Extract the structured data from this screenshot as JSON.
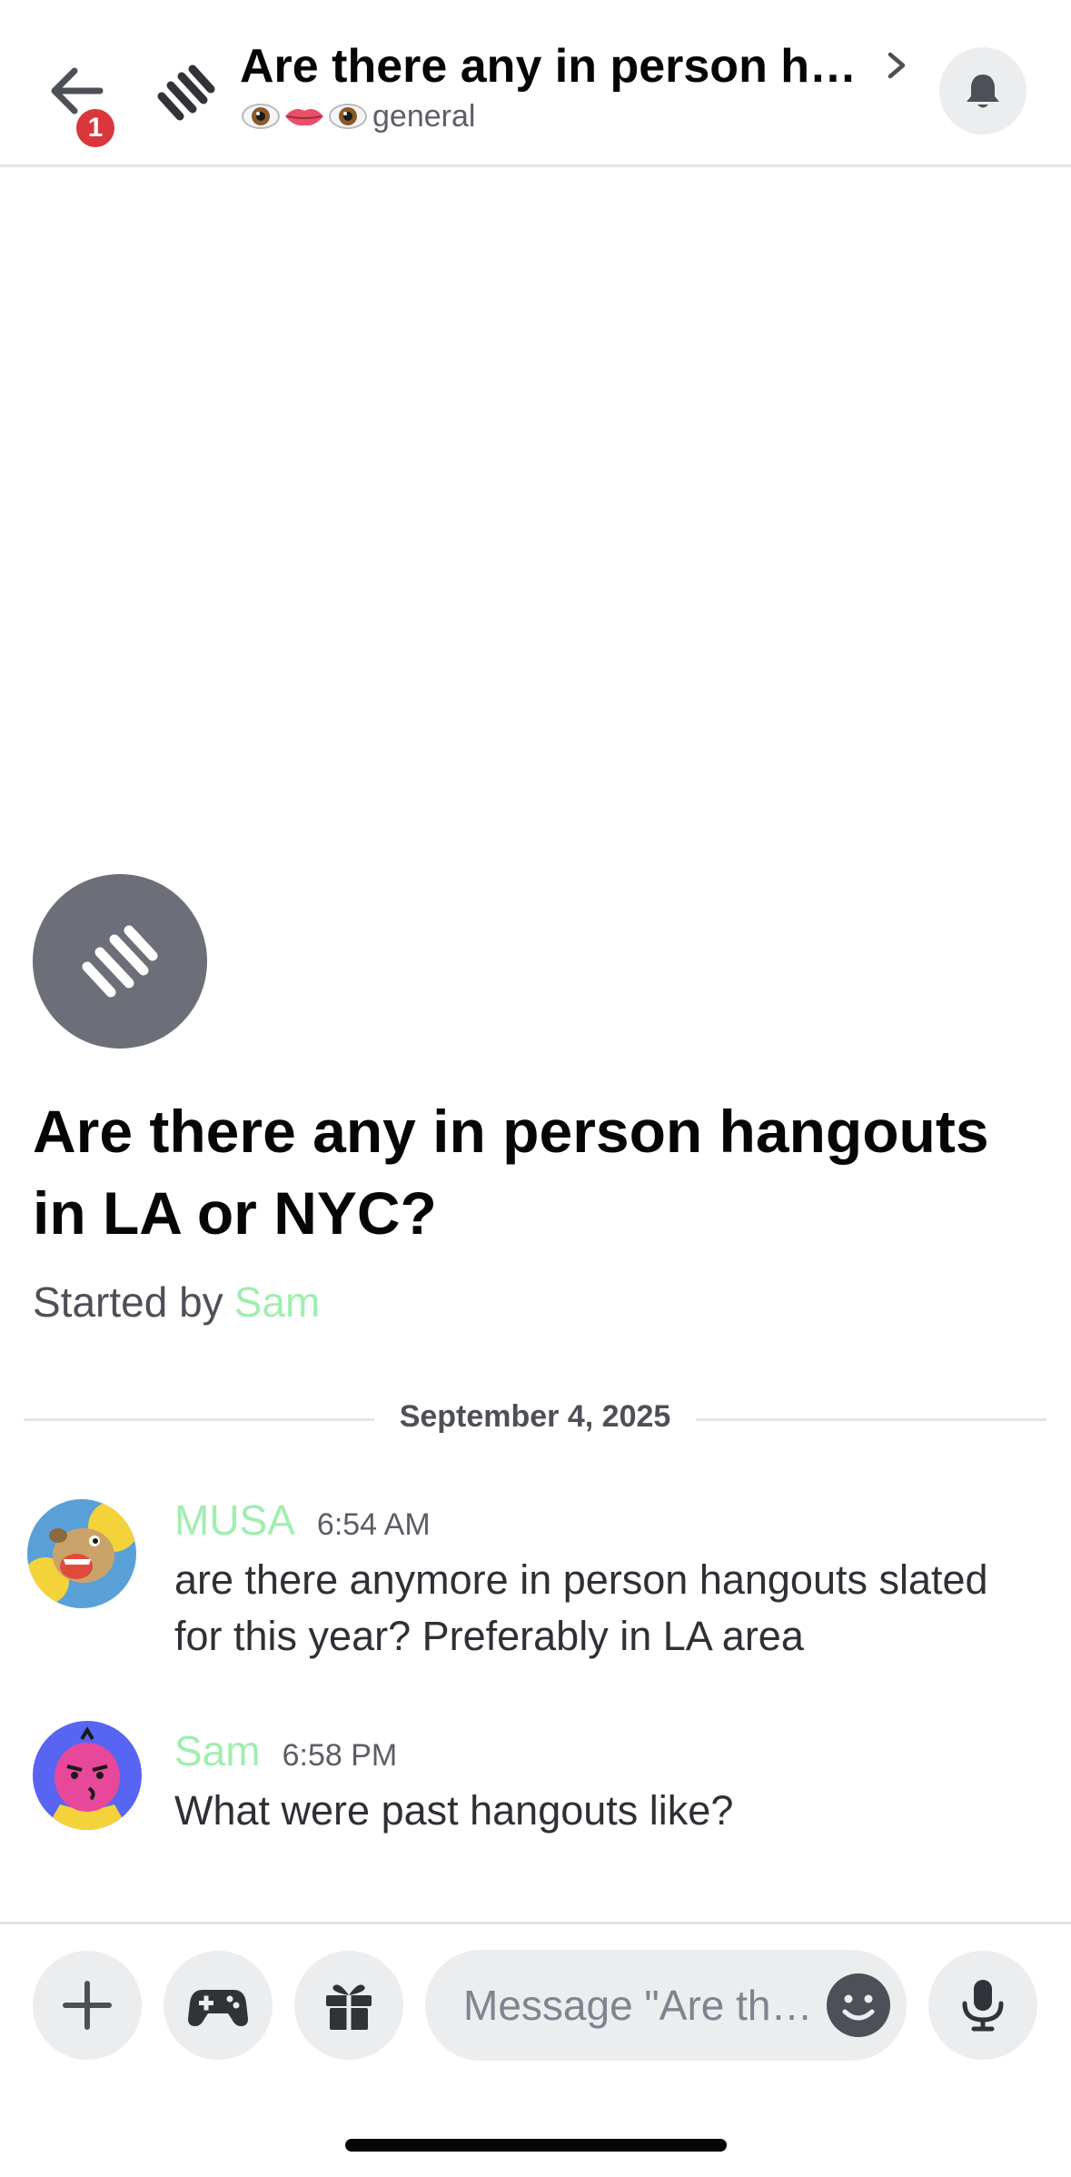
{
  "header": {
    "title": "Are there any in person hangouts in LA or NYC?",
    "unread_badge": "1",
    "channel_emojis": [
      "eye",
      "lips",
      "eye"
    ],
    "channel_name": "general"
  },
  "thread": {
    "title": "Are there any in person hangouts in LA or NYC?",
    "started_by_prefix": "Started by",
    "started_by_author": "Sam"
  },
  "date_divider": "September 4, 2025",
  "messages": [
    {
      "author": "MUSA",
      "time": "6:54 AM",
      "text": "are there anymore in person hangouts slated for this year? Preferably in LA area",
      "avatar_icon": "cartoon-bear-avatar"
    },
    {
      "author": "Sam",
      "time": "6:58 PM",
      "text": "What were past hangouts like?",
      "avatar_icon": "pink-blob-avatar"
    }
  ],
  "composer": {
    "placeholder": "Message \"Are there any in person hangouts in LA or NYC?\"",
    "buttons": [
      "plus-icon",
      "gamepad-icon",
      "gift-icon",
      "emoji-icon",
      "microphone-icon"
    ]
  },
  "colors": {
    "accent_green_name": "#a0eeb0",
    "badge_red": "#da373c",
    "button_bg": "#ebedef",
    "thread_icon_bg": "#6d6f78"
  }
}
